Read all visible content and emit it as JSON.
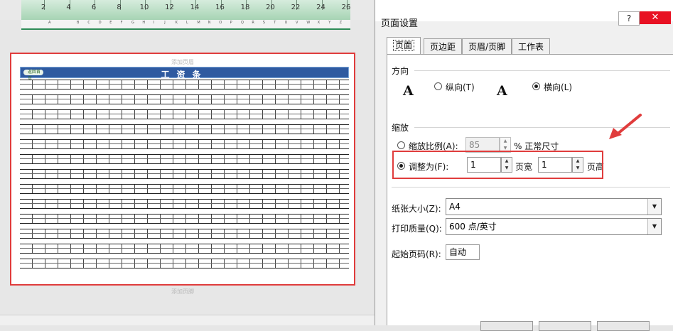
{
  "colors": {
    "accent_red": "#e03c3c",
    "title_blue": "#2f5aa0",
    "ruler_green": "#a7d4b4"
  },
  "excel": {
    "ruler_numbers": [
      "2",
      "4",
      "6",
      "8",
      "10",
      "12",
      "14",
      "16",
      "18",
      "20",
      "22",
      "24",
      "26"
    ],
    "column_letters": [
      "A",
      "B",
      "C",
      "D",
      "E",
      "F",
      "G",
      "H",
      "I",
      "J",
      "K",
      "L",
      "M",
      "N",
      "O",
      "P",
      "Q",
      "R",
      "S",
      "T",
      "U",
      "V",
      "W",
      "X",
      "Y",
      "Z"
    ],
    "header_placeholder": "添加页眉",
    "footer_placeholder": "添加页脚",
    "sheet_title": "工资条",
    "back_button_label": "返回首页"
  },
  "dialog": {
    "title": "页面设置",
    "help_label": "?",
    "close_label": "✕",
    "tabs": [
      {
        "label": "页面",
        "active": true
      },
      {
        "label": "页边距",
        "active": false
      },
      {
        "label": "页眉/页脚",
        "active": false
      },
      {
        "label": "工作表",
        "active": false
      }
    ],
    "orientation": {
      "section": "方向",
      "portrait_label": "纵向(T)",
      "landscape_label": "横向(L)",
      "selected": "landscape"
    },
    "scaling": {
      "section": "缩放",
      "adjust_label": "缩放比例(A):",
      "adjust_value": "85",
      "adjust_suffix": "% 正常尺寸",
      "fit_label": "调整为(F):",
      "pages_wide_value": "1",
      "pages_wide_label": "页宽",
      "pages_tall_value": "1",
      "pages_tall_label": "页高",
      "selected": "fit"
    },
    "paper_size": {
      "label": "纸张大小(Z):",
      "value": "A4"
    },
    "print_quality": {
      "label": "打印质量(Q):",
      "value": "600 点/英寸"
    },
    "first_page_number": {
      "label": "起始页码(R):",
      "value": "自动"
    }
  }
}
